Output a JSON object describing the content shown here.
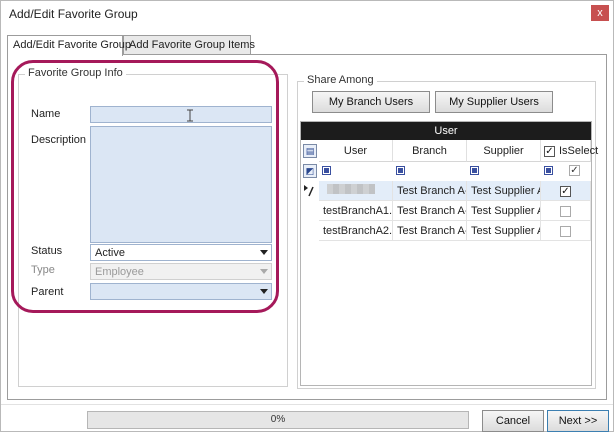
{
  "window": {
    "title": "Add/Edit Favorite Group",
    "close_glyph": "x"
  },
  "tabs": [
    {
      "label": "Add/Edit Favorite Group",
      "active": true
    },
    {
      "label": "Add Favorite Group Items",
      "active": false
    }
  ],
  "info": {
    "group_title": "Favorite Group Info",
    "name_label": "Name",
    "name_value": "",
    "description_label": "Description",
    "description_value": "",
    "status_label": "Status",
    "status_value": "Active",
    "type_label": "Type",
    "type_value": "Employee",
    "parent_label": "Parent",
    "parent_value": ""
  },
  "share": {
    "group_title": "Share Among",
    "branch_button": "My Branch Users",
    "supplier_button": "My Supplier Users",
    "grid_band": "User",
    "columns": [
      "User",
      "Branch",
      "Supplier",
      "IsSelect"
    ],
    "rows": [
      {
        "user": "",
        "branch": "Test Branch A-",
        "supplier": "Test Supplier A",
        "selected": true
      },
      {
        "user": "testBranchA1.u",
        "branch": "Test Branch A-",
        "supplier": "Test Supplier A",
        "selected": false
      },
      {
        "user": "testBranchA2.u",
        "branch": "Test Branch A-",
        "supplier": "Test Supplier A",
        "selected": false
      }
    ]
  },
  "footer": {
    "progress_text": "0%",
    "progress_value": 0,
    "cancel_label": "Cancel",
    "next_label": "Next >>"
  },
  "colors": {
    "highlight": "#a5195a",
    "field_bg": "#dbe6f4",
    "grid_band": "#1c1c1c"
  },
  "icons": [
    "close-icon",
    "text-cursor-icon",
    "dropdown-arrow-icon",
    "column-chooser-icon",
    "filter-row-icon",
    "edit-row-icon",
    "checkbox-icon"
  ]
}
